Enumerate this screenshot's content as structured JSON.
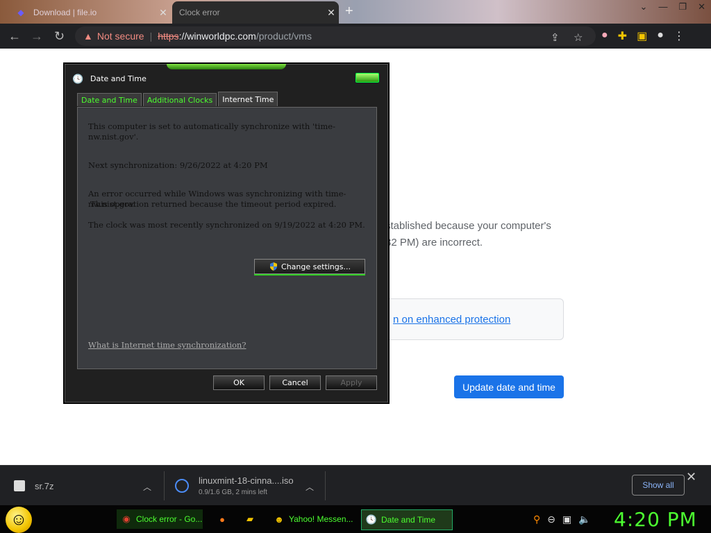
{
  "browser": {
    "tabs": [
      {
        "title": "Download | file.io",
        "active": false
      },
      {
        "title": "Clock error",
        "active": true
      }
    ],
    "address": {
      "security_label": "Not secure",
      "scheme": "https",
      "host": "://winworldpc.com",
      "path": "/product/vms"
    }
  },
  "page": {
    "error_line1": "stablished because your computer's",
    "error_line2": "32 PM) are incorrect.",
    "enhanced_protection_link": "n on enhanced protection",
    "update_button": "Update date and time"
  },
  "dialog": {
    "title": "Date and Time",
    "tabs": [
      "Date and Time",
      "Additional Clocks",
      "Internet Time"
    ],
    "sync_text": "This computer is set to automatically synchronize with 'time-nw.nist.gov'.",
    "next_sync": "Next synchronization: 9/26/2022 at 4:20 PM",
    "error_line1": "An error occurred while Windows was synchronizing with time-nw.nist.gov.",
    "error_line2": "This operation returned because the timeout period expired.",
    "last_sync": "The clock was most recently synchronized on 9/19/2022 at 4:20 PM.",
    "change_settings": "Change settings...",
    "help_link": "What is Internet time synchronization?",
    "buttons": {
      "ok": "OK",
      "cancel": "Cancel",
      "apply": "Apply"
    }
  },
  "downloads": {
    "items": [
      {
        "name": "sr.7z",
        "status": ""
      },
      {
        "name": "linuxmint-18-cinna....iso",
        "status": "0.9/1.6 GB, 2 mins left"
      }
    ],
    "show_all": "Show all"
  },
  "taskbar": {
    "items": [
      {
        "label": "Clock error - Go..."
      },
      {
        "label": ""
      },
      {
        "label": ""
      },
      {
        "label": "Yahoo! Messen..."
      },
      {
        "label": "Date and Time"
      }
    ],
    "clock": "4:20 PM"
  },
  "colors": {
    "accent_green": "#4cff30",
    "chrome_blue": "#1a73e8",
    "warning_red": "#f28b82"
  }
}
